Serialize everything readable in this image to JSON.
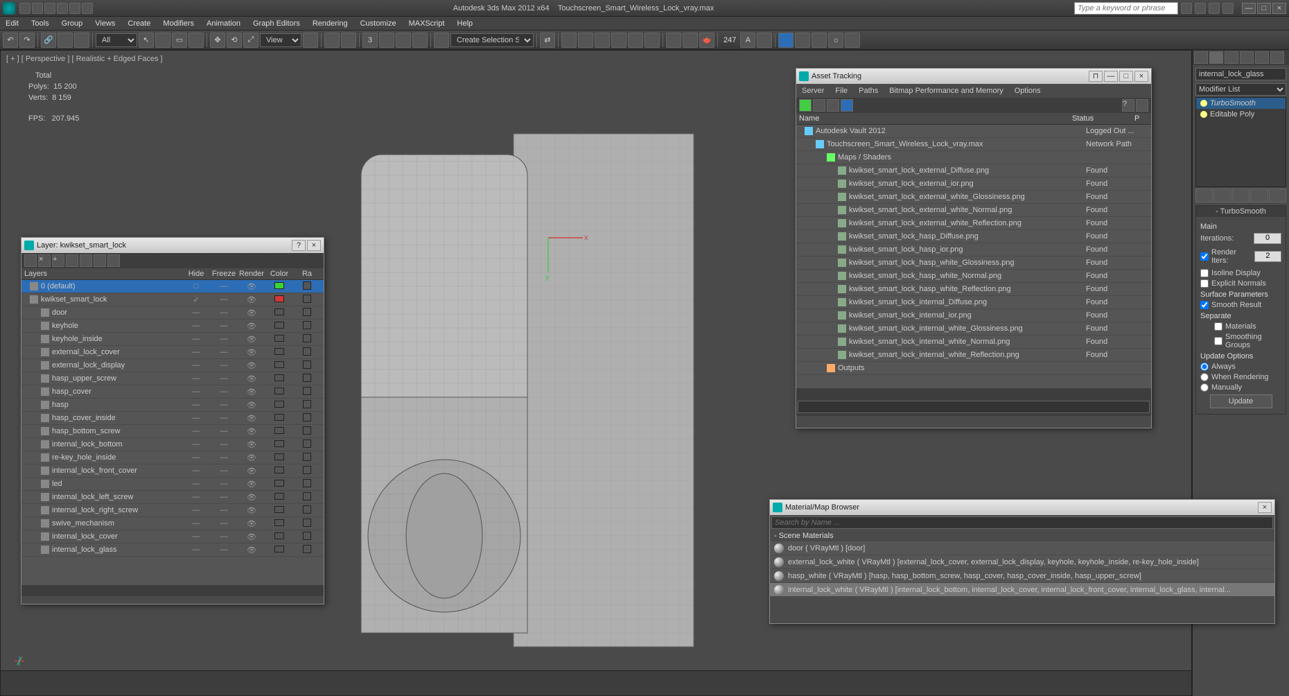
{
  "app": {
    "title": "Autodesk 3ds Max  2012 x64",
    "filename": "Touchscreen_Smart_Wireless_Lock_vray.max",
    "search_placeholder": "Type a keyword or phrase"
  },
  "menus": [
    "Edit",
    "Tools",
    "Group",
    "Views",
    "Create",
    "Modifiers",
    "Animation",
    "Graph Editors",
    "Rendering",
    "Customize",
    "MAXScript",
    "Help"
  ],
  "toolbar": {
    "selection_filter": "All",
    "named_sel": "Create Selection Se",
    "view_mode": "View",
    "count": "247"
  },
  "viewport": {
    "label": "[ + ] [ Perspective ] [ Realistic + Edged Faces ]",
    "stats": {
      "total": "Total",
      "polys_label": "Polys:",
      "polys": "15 200",
      "verts_label": "Verts:",
      "verts": "8 159",
      "fps_label": "FPS:",
      "fps": "207.945"
    }
  },
  "modify_panel": {
    "obj_name": "internal_lock_glass",
    "modlist_label": "Modifier List",
    "stack": [
      {
        "name": "TurboSmooth",
        "sel": true,
        "italic": true
      },
      {
        "name": "Editable Poly",
        "sel": false
      }
    ],
    "rollout": {
      "title": "TurboSmooth",
      "main": "Main",
      "iterations": "Iterations:",
      "iterations_val": "0",
      "render_iters": "Render Iters:",
      "render_iters_val": "2",
      "isoline": "Isoline Display",
      "explicit": "Explicit Normals",
      "surface": "Surface Parameters",
      "smooth_result": "Smooth Result",
      "separate": "Separate",
      "materials": "Materials",
      "smoothing_groups": "Smoothing Groups",
      "update_options": "Update Options",
      "always": "Always",
      "when_rendering": "When Rendering",
      "manually": "Manually",
      "update_btn": "Update"
    }
  },
  "layer_panel": {
    "title": "Layer: kwikset_smart_lock",
    "cols": [
      "Layers",
      "Hide",
      "Freeze",
      "Render",
      "Color",
      "Ra"
    ],
    "rows": [
      {
        "name": "0 (default)",
        "indent": 0,
        "sel": true,
        "color": "#3cd436",
        "hide": "□",
        "freeze": "—",
        "render": "👁",
        "ra": "□"
      },
      {
        "name": "kwikset_smart_lock",
        "indent": 0,
        "sel": false,
        "color": "#d43636",
        "hide": "✓",
        "freeze": "—",
        "render": "👁",
        "ra": "□"
      },
      {
        "name": "door",
        "indent": 1
      },
      {
        "name": "keyhole",
        "indent": 1
      },
      {
        "name": "keyhole_inside",
        "indent": 1
      },
      {
        "name": "external_lock_cover",
        "indent": 1
      },
      {
        "name": "external_lock_display",
        "indent": 1
      },
      {
        "name": "hasp_upper_screw",
        "indent": 1
      },
      {
        "name": "hasp_cover",
        "indent": 1
      },
      {
        "name": "hasp",
        "indent": 1
      },
      {
        "name": "hasp_cover_inside",
        "indent": 1
      },
      {
        "name": "hasp_bottom_screw",
        "indent": 1
      },
      {
        "name": "internal_lock_bottom",
        "indent": 1
      },
      {
        "name": "re-key_hole_inside",
        "indent": 1
      },
      {
        "name": "internal_lock_front_cover",
        "indent": 1
      },
      {
        "name": "led",
        "indent": 1
      },
      {
        "name": "internal_lock_left_screw",
        "indent": 1
      },
      {
        "name": "internal_lock_right_screw",
        "indent": 1
      },
      {
        "name": "swive_mechanism",
        "indent": 1
      },
      {
        "name": "internal_lock_cover",
        "indent": 1
      },
      {
        "name": "internal_lock_glass",
        "indent": 1
      }
    ]
  },
  "asset_panel": {
    "title": "Asset Tracking",
    "menus": [
      "Server",
      "File",
      "Paths",
      "Bitmap Performance and Memory",
      "Options"
    ],
    "cols": {
      "name": "Name",
      "status": "Status",
      "p": "P"
    },
    "rows": [
      {
        "name": "Autodesk Vault 2012",
        "status": "Logged Out ...",
        "indent": 0,
        "icon": "#6cf"
      },
      {
        "name": "Touchscreen_Smart_Wireless_Lock_vray.max",
        "status": "Network Path",
        "indent": 1,
        "icon": "#6cf"
      },
      {
        "name": "Maps / Shaders",
        "status": "",
        "indent": 2,
        "icon": "#6f6"
      },
      {
        "name": "kwikset_smart_lock_external_Diffuse.png",
        "status": "Found",
        "indent": 3,
        "icon": "#8a8"
      },
      {
        "name": "kwikset_smart_lock_external_ior.png",
        "status": "Found",
        "indent": 3,
        "icon": "#8a8"
      },
      {
        "name": "kwikset_smart_lock_external_white_Glossiness.png",
        "status": "Found",
        "indent": 3,
        "icon": "#8a8"
      },
      {
        "name": "kwikset_smart_lock_external_white_Normal.png",
        "status": "Found",
        "indent": 3,
        "icon": "#8a8"
      },
      {
        "name": "kwikset_smart_lock_external_white_Reflection.png",
        "status": "Found",
        "indent": 3,
        "icon": "#8a8"
      },
      {
        "name": "kwikset_smart_lock_hasp_Diffuse.png",
        "status": "Found",
        "indent": 3,
        "icon": "#8a8"
      },
      {
        "name": "kwikset_smart_lock_hasp_ior.png",
        "status": "Found",
        "indent": 3,
        "icon": "#8a8"
      },
      {
        "name": "kwikset_smart_lock_hasp_white_Glossiness.png",
        "status": "Found",
        "indent": 3,
        "icon": "#8a8"
      },
      {
        "name": "kwikset_smart_lock_hasp_white_Normal.png",
        "status": "Found",
        "indent": 3,
        "icon": "#8a8"
      },
      {
        "name": "kwikset_smart_lock_hasp_white_Reflection.png",
        "status": "Found",
        "indent": 3,
        "icon": "#8a8"
      },
      {
        "name": "kwikset_smart_lock_internal_Diffuse.png",
        "status": "Found",
        "indent": 3,
        "icon": "#8a8"
      },
      {
        "name": "kwikset_smart_lock_internal_ior.png",
        "status": "Found",
        "indent": 3,
        "icon": "#8a8"
      },
      {
        "name": "kwikset_smart_lock_internal_white_Glossiness.png",
        "status": "Found",
        "indent": 3,
        "icon": "#8a8"
      },
      {
        "name": "kwikset_smart_lock_internal_white_Normal.png",
        "status": "Found",
        "indent": 3,
        "icon": "#8a8"
      },
      {
        "name": "kwikset_smart_lock_internal_white_Reflection.png",
        "status": "Found",
        "indent": 3,
        "icon": "#8a8"
      },
      {
        "name": "Outputs",
        "status": "",
        "indent": 2,
        "icon": "#fa6"
      }
    ]
  },
  "mat_panel": {
    "title": "Material/Map Browser",
    "search_placeholder": "Search by Name ...",
    "group": "- Scene Materials",
    "rows": [
      {
        "name": "door  ( VRayMtl )  [door]",
        "sel": false
      },
      {
        "name": "external_lock_white ( VRayMtl ) [external_lock_cover, external_lock_display, keyhole, keyhole_inside, re-key_hole_inside]",
        "sel": false
      },
      {
        "name": "hasp_white ( VRayMtl ) [hasp, hasp_bottom_screw, hasp_cover, hasp_cover_inside, hasp_upper_screw]",
        "sel": false
      },
      {
        "name": "internal_lock_white ( VRayMtl ) [internal_lock_bottom, internal_lock_cover, internal_lock_front_cover, internal_lock_glass, internal...",
        "sel": true
      }
    ]
  }
}
